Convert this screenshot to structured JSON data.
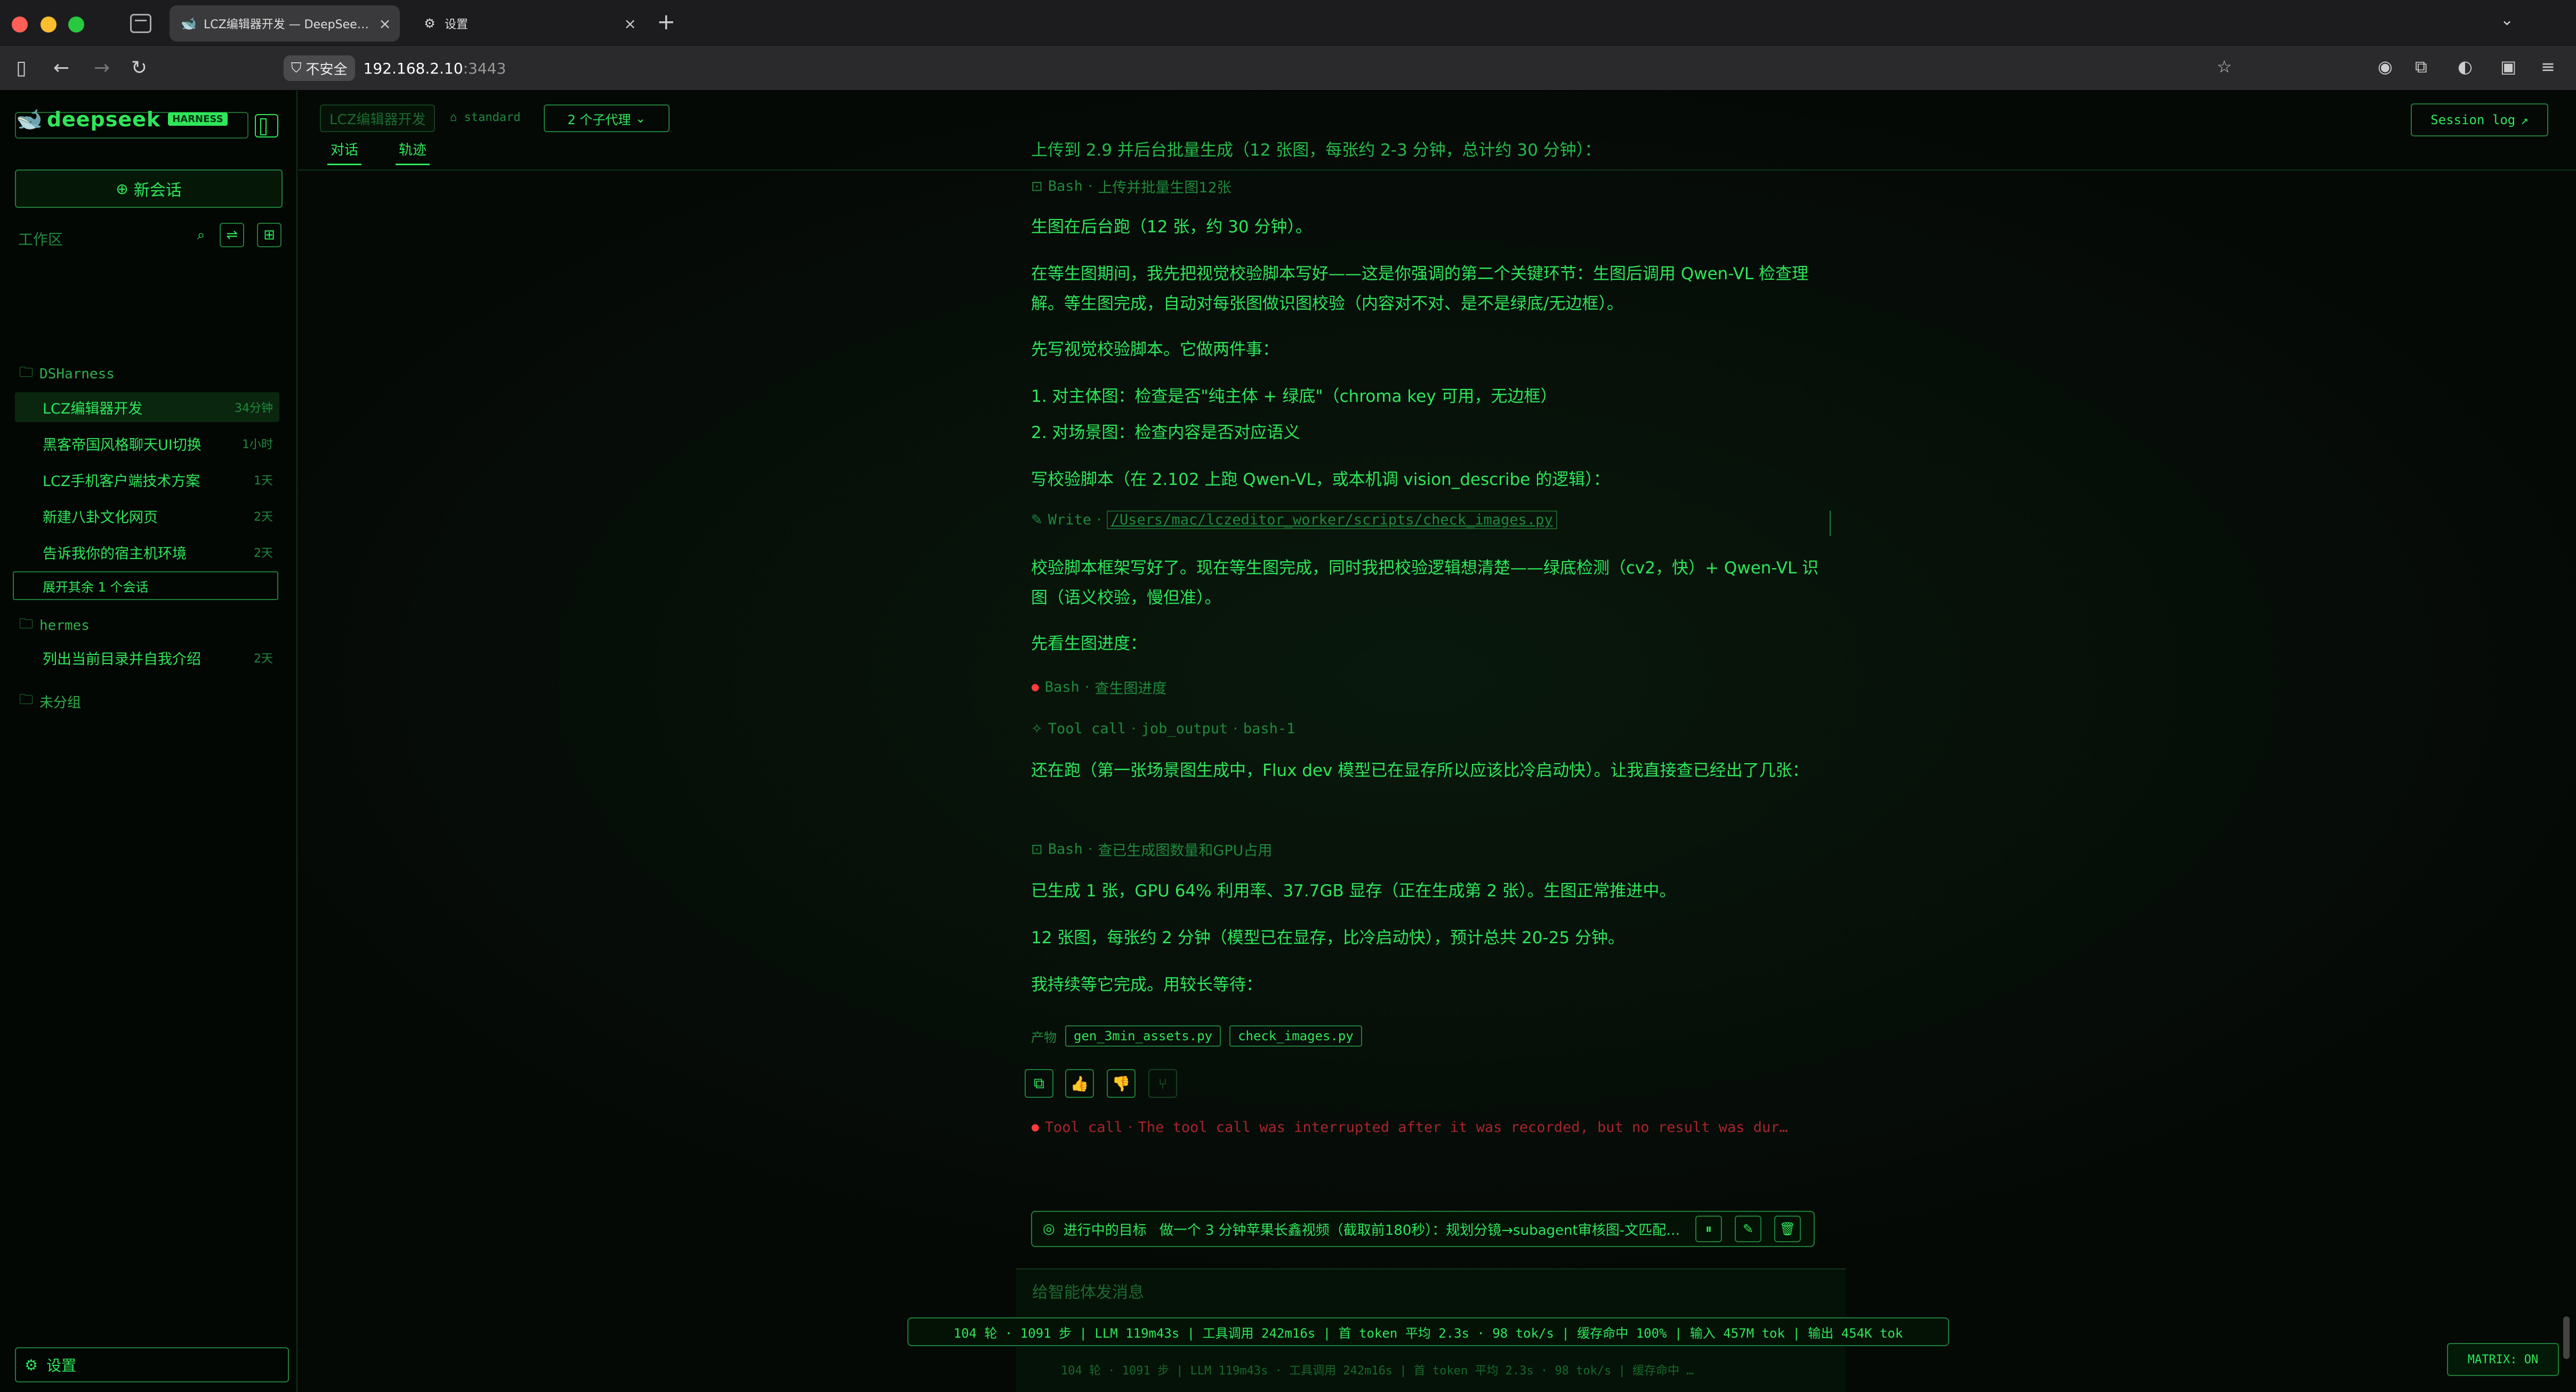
{
  "browser": {
    "active_tab_title": "LCZ编辑器开发 — DeepSeek Har",
    "settings_tab_title": "设置",
    "insecure_label": "不安全",
    "url_host": "192.168.2.10",
    "url_port": ":3443"
  },
  "sidebar": {
    "logo_text": "deepseek",
    "logo_badge": "HARNESS",
    "new_chat": "新会话",
    "workspace_label": "工作区",
    "groups": [
      {
        "name": "DSHarness"
      },
      {
        "name": "hermes"
      },
      {
        "name": "未分组"
      }
    ],
    "sessions": [
      {
        "name": "LCZ编辑器开发",
        "age": "34分钟"
      },
      {
        "name": "黑客帝国风格聊天UI切换",
        "age": "1小时"
      },
      {
        "name": "LCZ手机客户端技术方案",
        "age": "1天"
      },
      {
        "name": "新建八卦文化网页",
        "age": "2天"
      },
      {
        "name": "告诉我你的宿主机环境",
        "age": "2天"
      }
    ],
    "expand_more": "展开其余 1 个会话",
    "hermes_sessions": [
      {
        "name": "列出当前目录并自我介绍",
        "age": "2天"
      }
    ],
    "settings": "设置"
  },
  "topbar": {
    "project": "LCZ编辑器开发",
    "mode": "standard",
    "subagents": "2 个子代理",
    "tab_chat": "对话",
    "tab_trace": "轨迹",
    "session_log": "Session log"
  },
  "chat": {
    "m0": "上传到 2.9 并后台批量生成（12 张图，每张约 2-3 分钟，总计约 30 分钟）：",
    "t1_kind": "Bash",
    "t1_desc": "上传并批量生图12张",
    "m2": "生图在后台跑（12 张，约 30 分钟）。",
    "m3": "在等生图期间，我先把视觉校验脚本写好——这是你强调的第二个关键环节：生图后调用 Qwen-VL 检查理解。等生图完成，自动对每张图做识图校验（内容对不对、是不是绿底/无边框）。",
    "m4": "先写视觉校验脚本。它做两件事：",
    "m5": "1. 对主体图：检查是否\"纯主体 + 绿底\"（chroma key 可用，无边框）",
    "m6": "2. 对场景图：检查内容是否对应语义",
    "m7": "写校验脚本（在 2.102 上跑 Qwen-VL，或本机调 vision_describe 的逻辑）：",
    "t8_kind": "Write",
    "t8_path": "/Users/mac/lczeditor_worker/scripts/check_images.py",
    "m9": "校验脚本框架写好了。现在等生图完成，同时我把校验逻辑想清楚——绿底检测（cv2，快）+ Qwen-VL 识图（语义校验，慢但准）。",
    "m10": "先看生图进度：",
    "t11_kind": "Bash",
    "t11_desc": "查生图进度",
    "t12_kind": "Tool call",
    "t12_name": "job_output",
    "t12_arg": "bash-1",
    "m13": "还在跑（第一张场景图生成中，Flux dev 模型已在显存所以应该比冷启动快）。让我直接查已经出了几张：",
    "t14_kind": "Bash",
    "t14_desc": "查已生成图数量和GPU占用",
    "m15": "已生成 1 张，GPU 64% 利用率、37.7GB 显存（正在生成第 2 张）。生图正常推进中。",
    "m16": "12 张图，每张约 2 分钟（模型已在显存，比冷启动快），预计总共 20-25 分钟。",
    "m17": "我持续等它完成。用较长等待：",
    "artifacts_label": "产物",
    "artifacts": [
      "gen_3min_assets.py",
      "check_images.py"
    ],
    "t18_kind": "Tool call",
    "t18_desc": "The tool call was interrupted after it was recorded, but no result was dur…"
  },
  "goal": {
    "label": "进行中的目标",
    "text": "做一个 3 分钟苹果长鑫视频（截取前180秒）：规划分镜→subagent审核图-文匹配…"
  },
  "composer": {
    "placeholder": "给智能体发消息"
  },
  "stats": {
    "line": "104 轮 · 1091 步 | LLM 119m43s | 工具调用 242m16s | 首 token 平均 2.3s · 98 tok/s | 缓存命中 100% | 输入 457M tok | 输出 454K tok",
    "ghost": "104 轮 · 1091 步 |  LLM 119m43s · 工具调用 242m16s |  首 token 平均 2.3s · 98 tok/s |  缓存命中 …"
  },
  "matrix": "MATRIX: ON",
  "colors": {
    "accent": "#2fe65a",
    "dim": "#1f8a3c",
    "background": "#050906",
    "error": "#ff3b3b"
  }
}
